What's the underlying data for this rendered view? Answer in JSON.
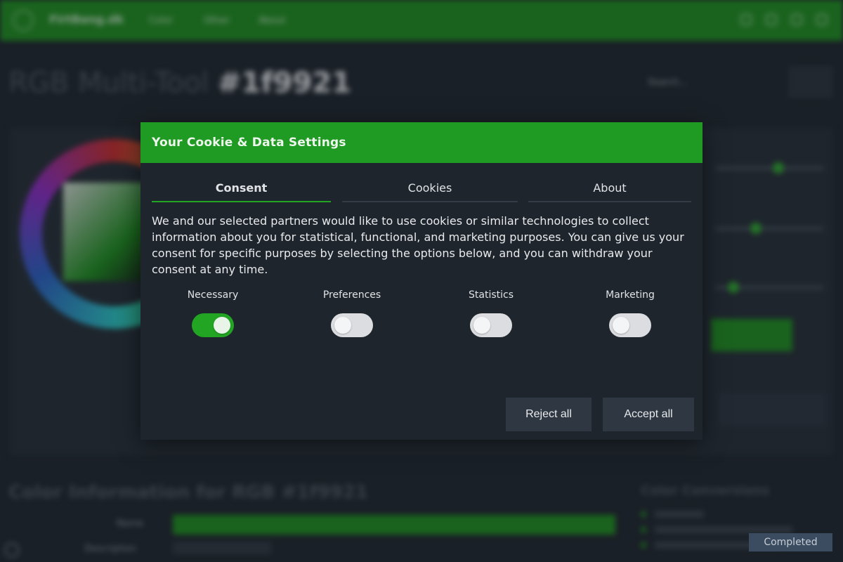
{
  "background": {
    "brand": "FirtBang.dk",
    "nav": [
      "Color",
      "Other",
      "About"
    ],
    "page_title_prefix": "RGB Multi-Tool",
    "page_title_hex": "#1f9921",
    "search_placeholder": "Search...",
    "color_info_title": "Color Information for RGB #1f9921",
    "color_conversions_title": "Color Conversions",
    "rows": {
      "name_label": "Name",
      "description_label": "Description"
    }
  },
  "modal": {
    "title": "Your Cookie & Data Settings",
    "tabs": [
      {
        "label": "Consent",
        "active": true
      },
      {
        "label": "Cookies",
        "active": false
      },
      {
        "label": "About",
        "active": false
      }
    ],
    "body_text": "We and our selected partners would like to use cookies or similar technologies to collect information about you for statistical, functional, and marketing purposes. You can give us your consent for specific purposes by selecting the options below, and you can withdraw your consent at any time.",
    "toggles": [
      {
        "label": "Necessary",
        "on": true
      },
      {
        "label": "Preferences",
        "on": false
      },
      {
        "label": "Statistics",
        "on": false
      },
      {
        "label": "Marketing",
        "on": false
      }
    ],
    "reject_label": "Reject all",
    "accept_label": "Accept all"
  },
  "status": {
    "label": "Completed"
  },
  "colors": {
    "accent_green": "#1f9a22",
    "toggle_on": "#22a523",
    "toggle_off": "#dcdde0",
    "button_bg": "#2e3742",
    "page_bg": "#1f252d"
  }
}
